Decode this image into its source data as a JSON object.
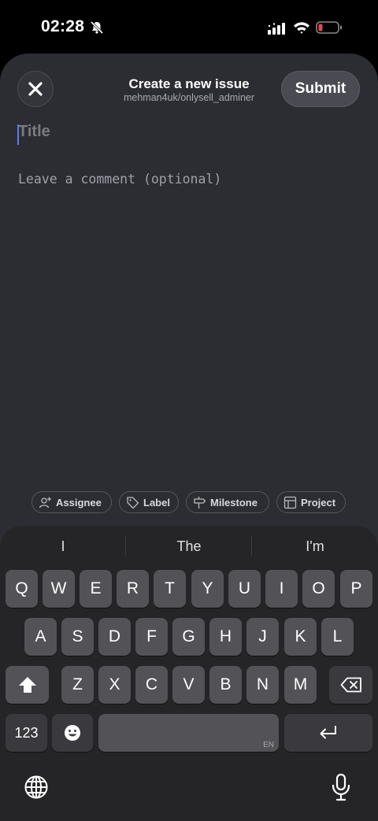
{
  "status_bar": {
    "time": "02:28"
  },
  "sheet": {
    "title": "Create a new issue",
    "repo": "mehman4uk/onlysell_adminer",
    "submit_label": "Submit",
    "title_placeholder": "Title",
    "comment_placeholder": "Leave a comment (optional)",
    "chips": [
      {
        "label": "Assignee",
        "icon": "add-person-icon"
      },
      {
        "label": "Label",
        "icon": "tag-icon"
      },
      {
        "label": "Milestone",
        "icon": "signpost-icon"
      },
      {
        "label": "Project",
        "icon": "table-icon"
      }
    ]
  },
  "keyboard": {
    "suggestions": [
      "I",
      "The",
      "I'm"
    ],
    "rows": [
      [
        "Q",
        "W",
        "E",
        "R",
        "T",
        "Y",
        "U",
        "I",
        "O",
        "P"
      ],
      [
        "A",
        "S",
        "D",
        "F",
        "G",
        "H",
        "J",
        "K",
        "L"
      ],
      [
        "Z",
        "X",
        "C",
        "V",
        "B",
        "N",
        "M"
      ]
    ],
    "numbers_label": "123",
    "language_label": "EN"
  },
  "colors": {
    "sheet_bg": "#2c2c33",
    "caret": "#5b7cf0",
    "battery_low": "#e5484d"
  }
}
